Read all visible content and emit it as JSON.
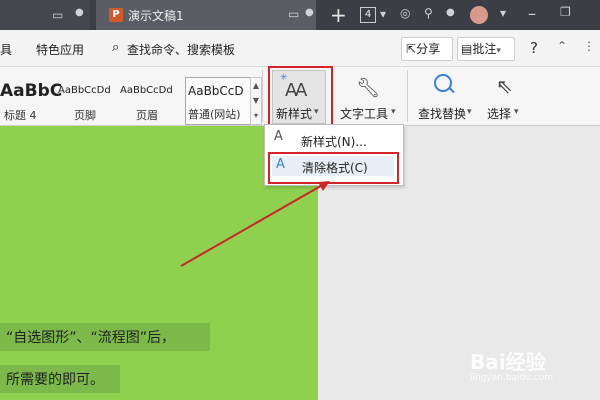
{
  "titlebar": {
    "tab_title": "演示文稿1",
    "tab_icon_letter": "P",
    "plus": "+",
    "tab_count": "4"
  },
  "menubar": {
    "left_partial": "具",
    "special_apps": "特色应用",
    "search_label": "查找命令、搜索模板",
    "share_label": "分享",
    "comment_label": "批注",
    "help": "?"
  },
  "styles_gallery": {
    "items": [
      {
        "sample": "AaBbC",
        "label": "标题 4"
      },
      {
        "sample": "AaBbCcDd",
        "label": "页脚"
      },
      {
        "sample": "AaBbCcDd",
        "label": "页眉"
      },
      {
        "sample": "AaBbCcD",
        "label": "普通(网站)"
      }
    ]
  },
  "ribbon": {
    "new_style_label": "新样式",
    "text_tools_label": "文字工具",
    "find_replace_label": "查找替换",
    "select_label": "选择"
  },
  "dropdown": {
    "new_style_item": "新样式(N)...",
    "clear_format_item": "清除格式(C)"
  },
  "document": {
    "line1": "“自选图形”、“流程图”后，",
    "line2": "所需要的即可。"
  },
  "watermark": {
    "brand": "Bai经验",
    "url": "jingyan.baidu.com"
  },
  "colors": {
    "doc_background": "#8fd14f",
    "highlight_box": "#d4242a",
    "arrow": "#c8282a",
    "titlebar": "#3b3f45"
  }
}
